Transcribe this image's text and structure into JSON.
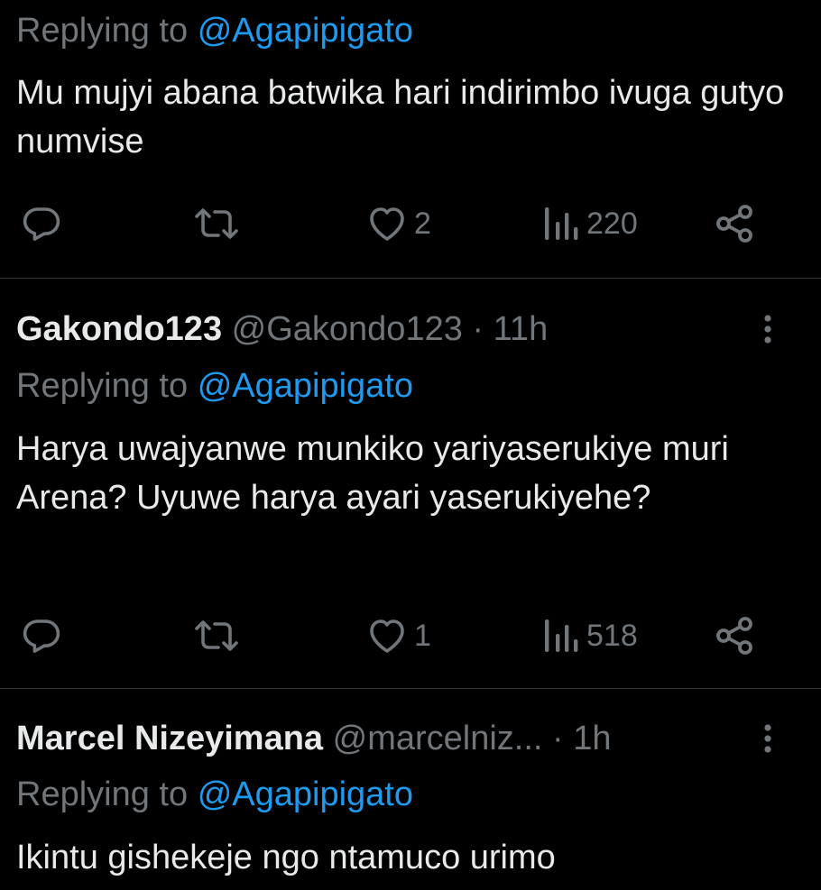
{
  "tweets": [
    {
      "replying_prefix": "Replying to",
      "replying_handle": "@Agapipigato",
      "text": "Mu mujyi abana batwika hari indirimbo ivuga gutyo numvise",
      "likes": "2",
      "views": "220"
    },
    {
      "name": "Gakondo123",
      "handle": "@Gakondo123",
      "time": "· 11h",
      "replying_prefix": "Replying to",
      "replying_handle": "@Agapipigato",
      "text": "Harya uwajyanwe munkiko yariyaserukiye muri Arena? Uyuwe harya ayari yaserukiyehe?",
      "likes": "1",
      "views": "518"
    },
    {
      "name": "Marcel Nizeyimana",
      "handle": "@marcelniz...",
      "time": "· 1h",
      "replying_prefix": "Replying to",
      "replying_handle": "@Agapipigato",
      "text": "Ikintu gishekeje ngo ntamuco urimo"
    }
  ],
  "icons": {
    "reply": "reply-icon",
    "repost": "repost-icon",
    "like": "heart-icon",
    "views": "views-icon",
    "share": "share-icon",
    "more": "more-icon"
  },
  "colors": {
    "background": "#000000",
    "text": "#e7e9ea",
    "secondary": "#71767b",
    "accent": "#1d9bf0",
    "divider": "#2f3336"
  }
}
